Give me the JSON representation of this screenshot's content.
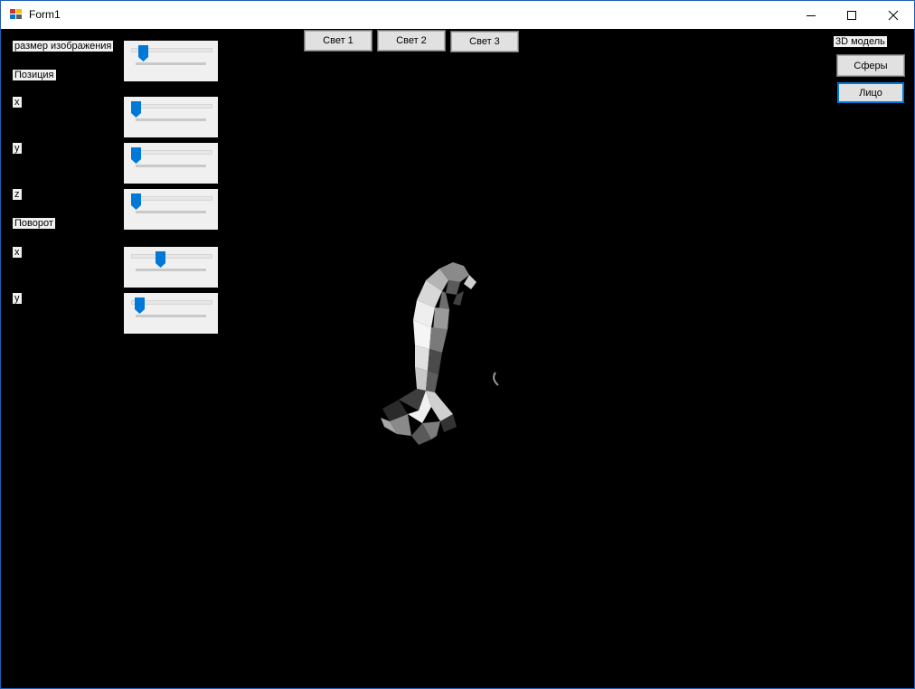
{
  "window": {
    "title": "Form1",
    "icons": {
      "app": "form-app-icon",
      "minimize": "minimize-icon",
      "maximize": "maximize-icon",
      "close": "close-icon"
    }
  },
  "labels": {
    "image_size": "размер изображения",
    "position": "Позиция",
    "pos_x": "x",
    "pos_y": "y",
    "pos_z": "z",
    "rotation": "Поворот",
    "rot_x": "x",
    "rot_y": "y",
    "model_group": "3D модель"
  },
  "sliders": {
    "image_size": 0.1,
    "pos_x": 0.0,
    "pos_y": 0.0,
    "pos_z": 0.0,
    "rot_x": 0.35,
    "rot_y": 0.05
  },
  "buttons": {
    "light1": "Свет 1",
    "light2": "Свет 2",
    "light3": "Свет 3",
    "spheres": "Сферы",
    "face": "Лицо"
  },
  "colors": {
    "accent": "#0078d7",
    "canvas": "#000000",
    "control": "#f0f0f0"
  }
}
